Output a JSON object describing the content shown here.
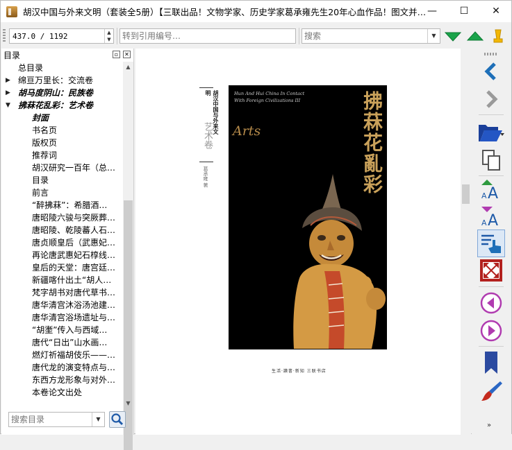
{
  "window": {
    "title": "胡汉中国与外来文明（套装全5册）【三联出品！文物学家、历史学家葛承雍先生20年心血作品！图文并…",
    "controls": {
      "minimize": "—",
      "maximize": "☐",
      "close": "✕"
    }
  },
  "toolbar": {
    "page_indicator": "437.0 / 1192",
    "ref_placeholder": "转到引用编号…",
    "search_placeholder": "搜索"
  },
  "sidebar": {
    "title": "目录",
    "search_placeholder": "搜索目录",
    "toc": [
      {
        "label": "总目录",
        "level": 0,
        "twisty": ""
      },
      {
        "label": "绵亘万里长：交流卷",
        "level": 0,
        "twisty": "▶"
      },
      {
        "label": "胡马度阴山：民族卷",
        "level": 0,
        "twisty": "▶"
      },
      {
        "label": "拂菻花乱彩：艺术卷",
        "level": 0,
        "twisty": "▼"
      },
      {
        "label": "封面",
        "level": 1,
        "twisty": ""
      },
      {
        "label": "书名页",
        "level": 1,
        "twisty": ""
      },
      {
        "label": "版权页",
        "level": 1,
        "twisty": ""
      },
      {
        "label": "推荐词",
        "level": 1,
        "twisty": ""
      },
      {
        "label": "胡汉研究一百年（总…",
        "level": 1,
        "twisty": ""
      },
      {
        "label": "目录",
        "level": 1,
        "twisty": ""
      },
      {
        "label": "前言",
        "level": 1,
        "twisty": ""
      },
      {
        "label": "“醉拂菻”：希腊酒…",
        "level": 1,
        "twisty": ""
      },
      {
        "label": "唐昭陵六骏与突厥葬…",
        "level": 1,
        "twisty": ""
      },
      {
        "label": "唐昭陵、乾陵蕃人石…",
        "level": 1,
        "twisty": ""
      },
      {
        "label": "唐贞顺皇后（武惠妃…",
        "level": 1,
        "twisty": ""
      },
      {
        "label": "再论唐武惠妃石椁线…",
        "level": 1,
        "twisty": ""
      },
      {
        "label": "皇后的天堂：唐宫廷…",
        "level": 1,
        "twisty": ""
      },
      {
        "label": "新疆喀什出土“胡人…",
        "level": 1,
        "twisty": ""
      },
      {
        "label": "梵字胡书对唐代草书…",
        "level": 1,
        "twisty": ""
      },
      {
        "label": "唐华清宫沐浴汤池建…",
        "level": 1,
        "twisty": ""
      },
      {
        "label": "唐华清宫浴场遗址与…",
        "level": 1,
        "twisty": ""
      },
      {
        "label": "“胡壍”传入与西域…",
        "level": 1,
        "twisty": ""
      },
      {
        "label": "唐代“日出”山水画…",
        "level": 1,
        "twisty": ""
      },
      {
        "label": "燃灯祈福胡伎乐——…",
        "level": 1,
        "twisty": ""
      },
      {
        "label": "唐代龙的演变特点与…",
        "level": 1,
        "twisty": ""
      },
      {
        "label": "东西方龙形象与对外…",
        "level": 1,
        "twisty": ""
      },
      {
        "label": "本卷论文出处",
        "level": 1,
        "twisty": ""
      }
    ]
  },
  "page": {
    "spine_series": "胡汉中国与外来文明",
    "spine_volume": "艺术卷",
    "spine_author": "葛承雍 著",
    "cover_en_1": "Hun And Hui China In Contact",
    "cover_en_2": "With Foreign Civilizations III",
    "cover_arts": "Arts",
    "cover_title": "拂菻花亂彩",
    "publisher": "生活·讀書·新知 三联书店"
  },
  "colors": {
    "cover_bg": "#000000",
    "title_gold": "#c9a15a",
    "accent_blue": "#1e5aa8",
    "accent_purple": "#b03bb0"
  }
}
